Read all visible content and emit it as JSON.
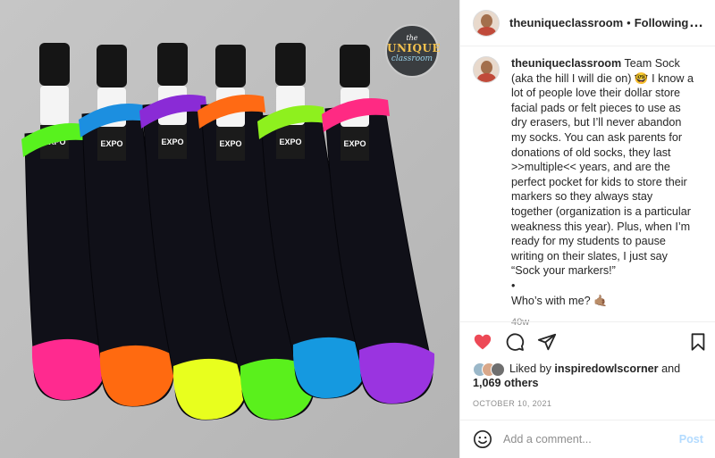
{
  "photo": {
    "brand_badge": {
      "line1": "the",
      "line2": "UNIQUE",
      "line3": "classroom"
    },
    "marker_brand": "EXPO",
    "sock_colors": [
      {
        "cuff": "#58f21e",
        "toe": "#ff2a8f"
      },
      {
        "cuff": "#1c8fe0",
        "toe": "#ff6a10"
      },
      {
        "cuff": "#8a2bd6",
        "toe": "#e8ff1e"
      },
      {
        "cuff": "#ff6a14",
        "toe": "#5af01c"
      },
      {
        "cuff": "#8ef01e",
        "toe": "#1599e0"
      },
      {
        "cuff": "#ff2a83",
        "toe": "#9a34e0"
      }
    ]
  },
  "header": {
    "username": "theuniqueclassroom",
    "separator": "•",
    "follow_status": "Following",
    "more_icon": "…"
  },
  "caption": {
    "username": "theuniqueclassroom",
    "text": " Team Sock\n(aka the hill I will die on) 🤓 I know a\nlot of people love their dollar store\nfacial pads or felt pieces to use as\ndry erasers, but I’ll never abandon\nmy socks. You can ask parents for\ndonations of old socks, they last\n>>multiple<< years, and are the\nperfect pocket for kids to store their\nmarkers so they always stay\ntogether (organization is a particular\nweakness this year). Plus, when I’m\nready for my students to pause\nwriting on their slates, I just say\n“Sock your markers!”\n•\nWho’s with me? 🤙🏽",
    "age": "40w"
  },
  "actions": {
    "like_icon": "heart-filled-icon",
    "comment_icon": "comment-icon",
    "share_icon": "paper-plane-icon",
    "save_icon": "bookmark-icon",
    "like_color": "#ed4956"
  },
  "likes": {
    "prefix": "Liked by ",
    "user": "inspiredowlscorner",
    "and": " and",
    "others": "1,069 others"
  },
  "date": "OCTOBER 10, 2021",
  "comment": {
    "placeholder": "Add a comment...",
    "post_label": "Post"
  }
}
